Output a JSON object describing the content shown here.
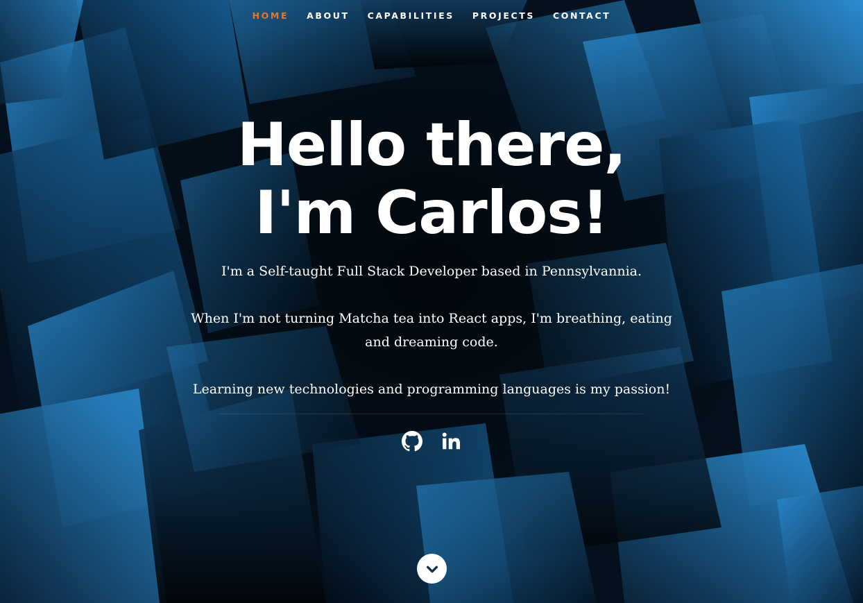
{
  "nav": {
    "items": [
      {
        "label": "HOME",
        "active": true
      },
      {
        "label": "ABOUT",
        "active": false
      },
      {
        "label": "CAPABILITIES",
        "active": false
      },
      {
        "label": "PROJECTS",
        "active": false
      },
      {
        "label": "CONTACT",
        "active": false
      }
    ],
    "active_color": "#e2772e"
  },
  "hero": {
    "title_line1": "Hello there,",
    "title_line2": "I'm Carlos!",
    "intro": "I'm a Self-taught Full Stack Developer based in Pennsylvannia.",
    "body": "When I'm not turning Matcha tea into React apps, I'm breathing, eating and dreaming code.",
    "passion": "Learning new technologies and programming languages is my passion!"
  },
  "social": {
    "icons": [
      "github-icon",
      "linkedin-icon"
    ]
  },
  "scroll": {
    "icon": "chevron-down-icon",
    "accent": "#0f4d7a"
  },
  "colors": {
    "background_dark": "#030a12",
    "background_blue": "#1f7fc4",
    "text": "#ffffff"
  }
}
